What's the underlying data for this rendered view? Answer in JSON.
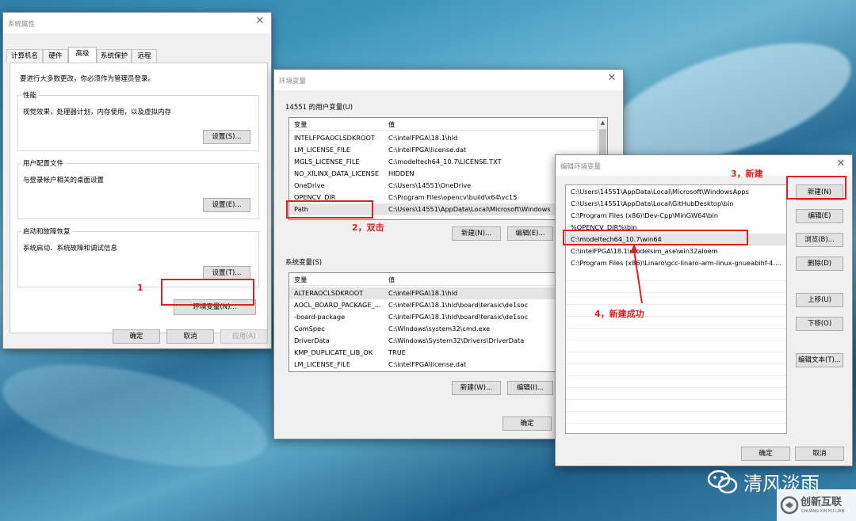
{
  "sys_props": {
    "title": "系统属性",
    "tabs": [
      "计算机名",
      "硬件",
      "高级",
      "系统保护",
      "远程"
    ],
    "admin_note": "要进行大多数更改，你必须作为管理员登录。",
    "performance": {
      "title": "性能",
      "desc": "视觉效果，处理器计划，内存使用，以及虚拟内存",
      "button": "设置(S)..."
    },
    "user_profile": {
      "title": "用户配置文件",
      "desc": "与登录帐户相关的桌面设置",
      "button": "设置(E)..."
    },
    "startup": {
      "title": "启动和故障恢复",
      "desc": "系统启动、系统故障和调试信息",
      "button": "设置(T)..."
    },
    "env_button": "环境变量(N)...",
    "ok": "确定",
    "cancel": "取消",
    "apply": "应用(A)"
  },
  "env_vars": {
    "title": "环境变量",
    "user_label": "14551 的用户变量(U)",
    "col_var": "变量",
    "col_val": "值",
    "user_rows": [
      {
        "name": "INTELFPGAOCLSDKROOT",
        "value": "C:\\intelFPGA\\18.1\\hld"
      },
      {
        "name": "LM_LICENSE_FILE",
        "value": "C:\\intelFPGA\\license.dat"
      },
      {
        "name": "MGLS_LICENSE_FILE",
        "value": "C:\\modeltech64_10.7\\LICENSE.TXT"
      },
      {
        "name": "NO_XILINX_DATA_LICENSE",
        "value": "HIDDEN"
      },
      {
        "name": "OneDrive",
        "value": "C:\\Users\\14551\\OneDrive"
      },
      {
        "name": "OPENCV_DIR",
        "value": "C:\\Program Files\\opencv\\build\\x64\\vc15"
      },
      {
        "name": "Path",
        "value": "C:\\Users\\14551\\AppData\\Local\\Microsoft\\Windows"
      }
    ],
    "user_new": "新建(N)...",
    "user_edit": "编辑(E)...",
    "sys_label": "系统变量(S)",
    "sys_rows": [
      {
        "name": "ALTERAOCLSDKROOT",
        "value": "C:\\intelFPGA\\18.1\\hld"
      },
      {
        "name": "AOCL_BOARD_PACKAGE_...",
        "value": "C:\\intelFPGA\\18.1\\hld\\board\\terasic\\de1soc"
      },
      {
        "name": "-board-package",
        "value": "C:\\intelFPGA\\18.1\\hld\\board\\terasic\\de1soc"
      },
      {
        "name": "ComSpec",
        "value": "C:\\Windows\\system32\\cmd.exe"
      },
      {
        "name": "DriverData",
        "value": "C:\\Windows\\System32\\Drivers\\DriverData"
      },
      {
        "name": "KMP_DUPLICATE_LIB_OK",
        "value": "TRUE"
      },
      {
        "name": "LM_LICENSE_FILE",
        "value": "C:\\intelFPGA\\license.dat"
      }
    ],
    "sys_new": "新建(W)...",
    "sys_edit": "编辑(I)...",
    "ok": "确定"
  },
  "edit_env": {
    "title": "编辑环境变量",
    "paths": [
      "C:\\Users\\14551\\AppData\\Local\\Microsoft\\WindowsApps",
      "C:\\Users\\14551\\AppData\\Local\\GitHubDesktop\\bin",
      "C:\\Program Files (x86)\\Dev-Cpp\\MinGW64\\bin",
      "%OPENCV_DIR%\\bin",
      "C:\\modeltech64_10.7\\win64",
      "C:\\intelFPGA\\18.1\\modelsim_ase\\win32aloem",
      "C:\\Program Files (x86)\\Linaro\\gcc-linaro-arm-linux-gnueabihf-4...."
    ],
    "new": "新建(N)",
    "edit": "编辑(E)",
    "browse": "浏览(B)...",
    "delete": "删除(D)",
    "up": "上移(U)",
    "down": "下移(O)",
    "edit_text": "编辑文本(T)...",
    "ok": "确定",
    "cancel": "取消"
  },
  "annotations": {
    "step1": "1",
    "step2": "2，双击",
    "step3": "3，新建",
    "step4": "4，新建成功"
  },
  "watermark": {
    "wechat": "清风淡雨",
    "brand": "创新互联",
    "brand_sub": "CHUANG XIN HU LIAN"
  },
  "colors": {
    "annotation_red": "#e02020",
    "dialog_bg": "#f0f0f0"
  }
}
